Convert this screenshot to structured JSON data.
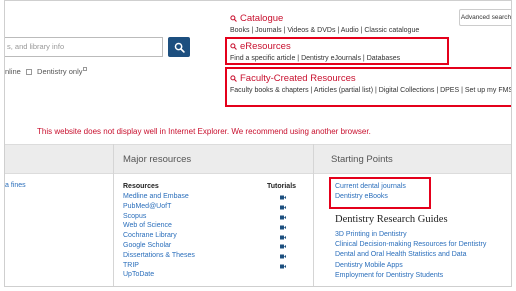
{
  "search": {
    "placeholder": "s, and library info",
    "button_icon": "search-icon",
    "filters": {
      "online_label": "nline",
      "dentistry_label": "Dentistry only"
    }
  },
  "header": {
    "advanced_search_label": "Advanced search"
  },
  "groups": {
    "catalogue": {
      "title": "Catalogue",
      "links": "Books | Journals | Videos & DVDs | Audio | Classic catalogue"
    },
    "eresources": {
      "title": "eResources",
      "links": "Find a specific article | Dentistry eJournals | Databases"
    },
    "faculty": {
      "title": "Faculty-Created Resources",
      "links": "Faculty books & chapters | Articles (partial list) | Digital Collections | DPES | Set up my FMS"
    }
  },
  "warning": "This website does not display well in Internet Explorer. We recommend using another browser.",
  "left_column": {
    "link": "a fines"
  },
  "major_resources": {
    "title": "Major resources",
    "resources_heading": "Resources",
    "tutorials_heading": "Tutorials",
    "items": [
      "Medline and Embase",
      "PubMed@UofT",
      "Scopus",
      "Web of Science",
      "Cochrane Library",
      "Google Scholar",
      "Dissertations & Theses",
      "TRIP",
      "UpToDate"
    ],
    "tutorial_icon": "video-camera-icon"
  },
  "starting_points": {
    "title": "Starting Points",
    "links": [
      "Current dental journals",
      "Dentistry eBooks"
    ],
    "guides_title": "Dentistry Research Guides",
    "guides": [
      "3D Printing in Dentistry",
      "Clinical Decision-making Resources for Dentistry",
      "Dental and Oral Health Statistics and Data",
      "Dentistry Mobile Apps",
      "Employment for Dentistry Students"
    ]
  },
  "colors": {
    "accent_red": "#c8102e",
    "link_blue": "#2a6ebb",
    "button_navy": "#1d4f7f",
    "highlight_box": "#e4001b"
  }
}
